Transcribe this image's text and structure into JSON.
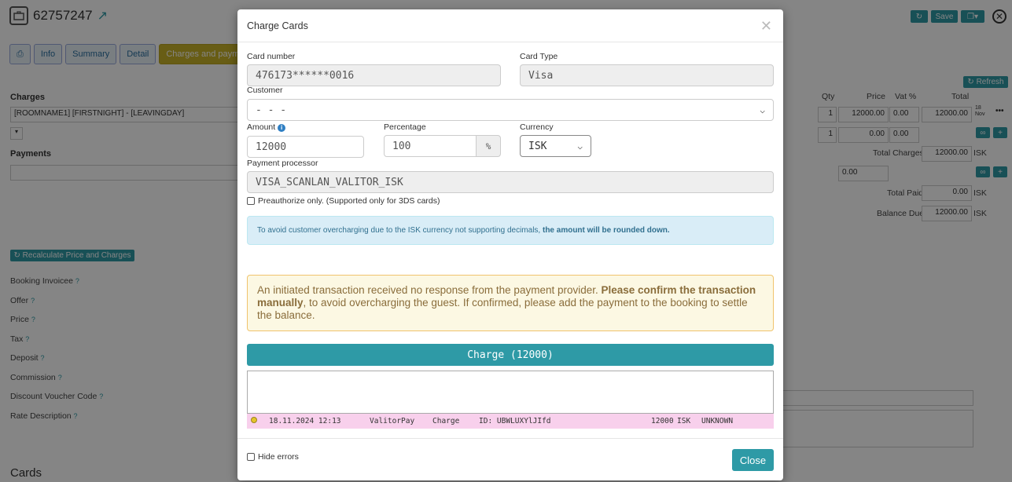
{
  "page": {
    "booking_id": "62757247",
    "tabs": [
      "Info",
      "Summary",
      "Detail",
      "Charges and payments"
    ],
    "refresh_label": "Refresh",
    "save_label": "Save",
    "charges_heading": "Charges",
    "charge_row": "[ROOMNAME1] [FIRSTNIGHT] - [LEAVINGDAY]",
    "payments_heading": "Payments",
    "recalc_label": "Recalculate Price and Charges",
    "fields": [
      "Booking Invoicee",
      "Offer",
      "Price",
      "Tax",
      "Deposit",
      "Commission",
      "Discount Voucher Code",
      "Rate Description"
    ],
    "cards_heading": "Cards",
    "table": {
      "headers": [
        "Qty",
        "Price",
        "Vat %",
        "Total"
      ],
      "row1": {
        "qty": "1",
        "price": "12000.00",
        "vat": "0.00",
        "total": "12000.00",
        "date_day": "18",
        "date_month": "Nov"
      },
      "row2": {
        "qty": "1",
        "price": "0.00",
        "vat": "0.00"
      },
      "total_charges_label": "Total Charges",
      "total_charges": "12000.00",
      "payment_price": "0.00",
      "total_paid_label": "Total Paid",
      "total_paid": "0.00",
      "balance_due_label": "Balance Due",
      "balance_due": "12000.00",
      "currency": "ISK"
    }
  },
  "modal": {
    "title": "Charge Cards",
    "card_number_label": "Card number",
    "card_number": "476173******0016",
    "card_type_label": "Card Type",
    "card_type": "Visa",
    "customer_label": "Customer",
    "customer_value": "- - -",
    "amount_label": "Amount",
    "amount": "12000",
    "percentage_label": "Percentage",
    "percentage": "100",
    "percent_symbol": "%",
    "currency_label": "Currency",
    "currency": "ISK",
    "processor_label": "Payment processor",
    "processor": "VISA_SCANLAN_VALITOR_ISK",
    "preauth_label": "Preauthorize only. (Supported only for 3DS cards)",
    "info_text": "To avoid customer overcharging due to the ISK currency not supporting decimals,",
    "info_bold": "the amount will be rounded down.",
    "warn_text1": "An initiated transaction received no response from the payment provider.",
    "warn_bold1": "Please confirm the transaction",
    "warn_bold2": "manually",
    "warn_text2": ", to avoid overcharging the guest. If confirmed, please add the payment to the booking to settle the balance.",
    "charge_button": "Charge (12000)",
    "log": {
      "datetime": "18.11.2024 12:13",
      "provider": "ValitorPay",
      "type": "Charge",
      "id": "ID: UBWLUXYlJIfd",
      "amount": "12000",
      "currency": "ISK",
      "status": "UNKNOWN"
    },
    "hide_errors_label": "Hide errors",
    "close_button": "Close"
  },
  "colors": {
    "accent": "#2e9aa6",
    "warning_bg": "#fcf8e3",
    "info_bg": "#d9edf7",
    "log_row": "#f8d0ec"
  }
}
